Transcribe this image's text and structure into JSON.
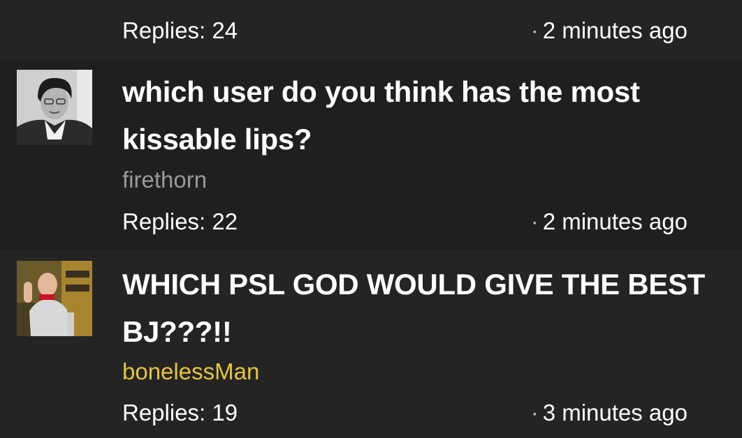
{
  "threads": [
    {
      "replies_label": "Replies: 24",
      "time_separator": "·",
      "time_ago": "2 minutes ago"
    },
    {
      "title": "which user do you think has the most kissable lips?",
      "author": "firethorn",
      "replies_label": "Replies: 22",
      "time_separator": "·",
      "time_ago": "2 minutes ago",
      "avatar_icon": "user-photo-bw"
    },
    {
      "title": "WHICH PSL GOD WOULD GIVE THE BEST BJ???!!",
      "author": "bonelessMan",
      "author_color": "#e8c33a",
      "replies_label": "Replies: 19",
      "time_separator": "·",
      "time_ago": "3 minutes ago",
      "avatar_icon": "user-photo-color"
    }
  ]
}
